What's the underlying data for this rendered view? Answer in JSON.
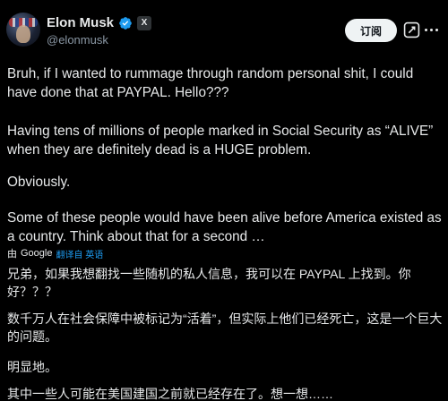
{
  "author": {
    "display_name": "Elon Musk",
    "handle": "@elonmusk",
    "badge_label": "X"
  },
  "header": {
    "subscribe_label": "订阅"
  },
  "tweet": {
    "paragraphs": [
      "Bruh, if I wanted to rummage through random personal shit, I could have done that at PAYPAL. Hello???",
      "Having tens of millions of people marked in Social Security as “ALIVE” when they are definitely dead is a HUGE problem.",
      "Obviously.",
      "Some of these people would have been alive before America existed as a country. Think about that for a second …"
    ]
  },
  "translation": {
    "by_label": "由",
    "provider": "Google",
    "translate_label": "翻译自 英语",
    "paragraphs": [
      "兄弟，如果我想翻找一些随机的私人信息，我可以在 PAYPAL 上找到。你好？？？",
      "数千万人在社会保障中被标记为“活着”，但实际上他们已经死亡，这是一个巨大的问题。",
      "明显地。",
      "其中一些人可能在美国建国之前就已经存在了。想一想……"
    ]
  },
  "colors": {
    "background": "#000000",
    "text": "#e7e9ea",
    "secondary": "#8b98a5",
    "verified": "#1d9bf0",
    "link": "#1d9bf0"
  },
  "icons": [
    "verified-badge-icon",
    "grok-icon",
    "more-icon"
  ]
}
